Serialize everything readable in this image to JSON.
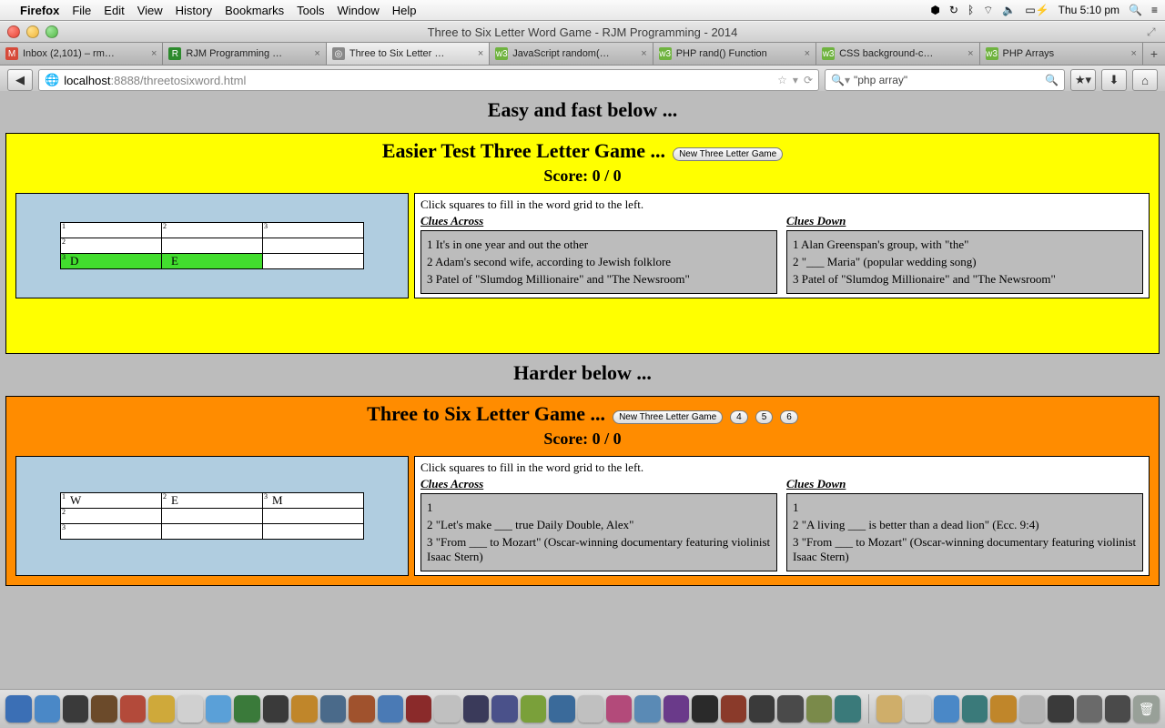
{
  "menubar": {
    "app": "Firefox",
    "items": [
      "File",
      "Edit",
      "View",
      "History",
      "Bookmarks",
      "Tools",
      "Window",
      "Help"
    ],
    "right": {
      "clock": "Thu 5:10 pm"
    }
  },
  "window": {
    "title": "Three to Six Letter Word Game - RJM Programming - 2014"
  },
  "tabs": [
    {
      "label": "Inbox (2,101) – rm…",
      "active": false,
      "fav": "M",
      "favbg": "#d64a3a"
    },
    {
      "label": "RJM Programming …",
      "active": false,
      "fav": "R",
      "favbg": "#2c8a2c"
    },
    {
      "label": "Three to Six Letter …",
      "active": true,
      "fav": "◎",
      "favbg": "#888"
    },
    {
      "label": "JavaScript random(…",
      "active": false,
      "fav": "w3",
      "favbg": "#6fb33f"
    },
    {
      "label": "PHP rand() Function",
      "active": false,
      "fav": "w3",
      "favbg": "#6fb33f"
    },
    {
      "label": "CSS background-c…",
      "active": false,
      "fav": "w3",
      "favbg": "#6fb33f"
    },
    {
      "label": "PHP Arrays",
      "active": false,
      "fav": "w3",
      "favbg": "#6fb33f"
    }
  ],
  "toolbar": {
    "back": "◀",
    "url_host": "localhost",
    "url_port": ":8888",
    "url_path": "/threetosixword.html",
    "search_value": "\"php array\""
  },
  "page": {
    "section1_title": "Easy and fast below ...",
    "section2_title": "Harder below ...",
    "game1": {
      "title": "Easier Test Three Letter Game ...",
      "newbtn": "New Three Letter Game",
      "score": "Score: 0 / 0",
      "instruct": "Click squares to fill in the word grid to the left.",
      "across_hdr": "Clues Across",
      "down_hdr": "Clues Down",
      "grid": [
        [
          {
            "n": "1",
            "v": "",
            "g": false
          },
          {
            "n": "2",
            "v": "",
            "g": false
          },
          {
            "n": "3",
            "v": "",
            "g": false
          }
        ],
        [
          {
            "n": "2",
            "v": "",
            "g": false
          },
          {
            "n": "",
            "v": "",
            "g": false
          },
          {
            "n": "",
            "v": "",
            "g": false
          }
        ],
        [
          {
            "n": "3",
            "v": "D",
            "g": true
          },
          {
            "n": "",
            "v": "E",
            "g": true
          },
          {
            "n": "",
            "v": "",
            "g": false
          }
        ]
      ],
      "across": [
        "1 It's in one year and out the other",
        "2 Adam's second wife, according to Jewish folklore",
        "3 Patel of \"Slumdog Millionaire\" and \"The Newsroom\""
      ],
      "down": [
        "1 Alan Greenspan's group, with \"the\"",
        "2 \"___ Maria\" (popular wedding song)",
        "3 Patel of \"Slumdog Millionaire\" and \"The Newsroom\""
      ]
    },
    "game2": {
      "title": "Three to Six Letter Game ...",
      "newbtn": "New Three Letter Game",
      "btns": [
        "4",
        "5",
        "6"
      ],
      "score": "Score: 0 / 0",
      "instruct": "Click squares to fill in the word grid to the left.",
      "across_hdr": "Clues Across",
      "down_hdr": "Clues Down",
      "grid": [
        [
          {
            "n": "1",
            "v": "W",
            "g": false
          },
          {
            "n": "2",
            "v": "E",
            "g": false
          },
          {
            "n": "3",
            "v": "M",
            "g": false
          }
        ],
        [
          {
            "n": "2",
            "v": "",
            "g": false
          },
          {
            "n": "",
            "v": "",
            "g": false
          },
          {
            "n": "",
            "v": "",
            "g": false
          }
        ],
        [
          {
            "n": "3",
            "v": "",
            "g": false
          },
          {
            "n": "",
            "v": "",
            "g": false
          },
          {
            "n": "",
            "v": "",
            "g": false
          }
        ]
      ],
      "across": [
        "1",
        "2 \"Let's make ___ true Daily Double, Alex\"",
        "3 \"From ___ to Mozart\" (Oscar-winning documentary featuring violinist Isaac Stern)"
      ],
      "down": [
        "1",
        "2 \"A living ___ is better than a dead lion\" (Ecc. 9:4)",
        "3 \"From ___ to Mozart\" (Oscar-winning documentary featuring violinist Isaac Stern)"
      ]
    }
  },
  "dock_colors": [
    "#3b6fb5",
    "#4a88c7",
    "#3a3a3a",
    "#6b4a2a",
    "#b34a3a",
    "#cfa93a",
    "#d0d0d0",
    "#5aa0d8",
    "#3a7a3a",
    "#3a3a3a",
    "#c0862a",
    "#4a6a8a",
    "#a0522d",
    "#4a7ab5",
    "#8a2a2a",
    "#c0c0c0",
    "#3a3a5a",
    "#4a518a",
    "#7aa03a",
    "#3a6a9a",
    "#c0c0c0",
    "#b34a7a",
    "#5a8ab5",
    "#6a3a8a",
    "#2a2a2a",
    "#8a3a2a",
    "#3a3a3a",
    "#4a4a4a",
    "#7a8a4a",
    "#3a7a7a"
  ]
}
